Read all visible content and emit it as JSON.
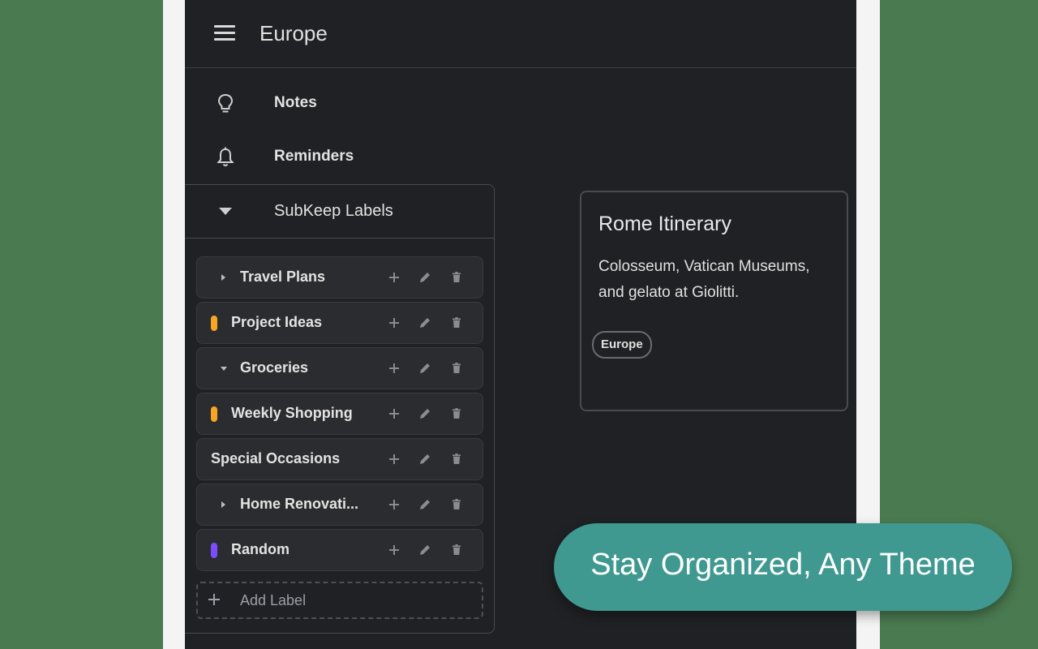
{
  "header": {
    "title": "Europe"
  },
  "nav": {
    "notes": {
      "label": "Notes",
      "icon": "lightbulb-icon"
    },
    "reminders": {
      "label": "Reminders",
      "icon": "bell-icon"
    }
  },
  "labels_section": {
    "title": "SubKeep Labels",
    "items": [
      {
        "name": "Travel Plans",
        "marker": "collapsed-arrow"
      },
      {
        "name": "Project Ideas",
        "marker": "color-dot",
        "color": "#f6a623"
      },
      {
        "name": "Groceries",
        "marker": "expanded-arrow"
      },
      {
        "name": "Weekly Shopping",
        "marker": "color-dot",
        "color": "#f6a623"
      },
      {
        "name": "Special Occasions",
        "marker": "none"
      },
      {
        "name": "Home Renovati...",
        "marker": "collapsed-arrow"
      },
      {
        "name": "Random",
        "marker": "color-dot",
        "color": "#7c4dff"
      }
    ],
    "add_label": "Add Label"
  },
  "note": {
    "title": "Rome Itinerary",
    "body": "Colosseum, Vatican Museums, and gelato at Giolitti.",
    "chip": "Europe"
  },
  "promo": {
    "text": "Stay Organized, Any Theme"
  },
  "colors": {
    "background": "#4a7a50",
    "app": "#202124",
    "promo": "#3f9990"
  }
}
